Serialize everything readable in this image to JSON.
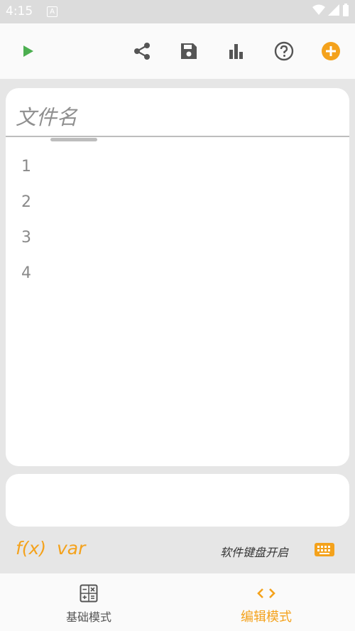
{
  "status_bar": {
    "time": "4:15",
    "indicator": "A"
  },
  "toolbar": {
    "icons": [
      "run-icon",
      "share-icon",
      "save-icon",
      "chart-icon",
      "help-icon",
      "add-icon"
    ]
  },
  "editor": {
    "filename_placeholder": "文件名",
    "line_numbers": [
      "1",
      "2",
      "3",
      "4"
    ]
  },
  "footer": {
    "fx_label": "f(x)",
    "var_label": "var",
    "keyboard_label": "软件键盘开启"
  },
  "bottom_nav": {
    "tabs": [
      {
        "label": "基础模式",
        "icon": "calculator-icon",
        "active": false
      },
      {
        "label": "编辑模式",
        "icon": "code-icon",
        "active": true
      }
    ]
  },
  "colors": {
    "accent": "#f4a21c",
    "run": "#4caf50",
    "icon": "#555555",
    "inactive_text": "#555555"
  }
}
